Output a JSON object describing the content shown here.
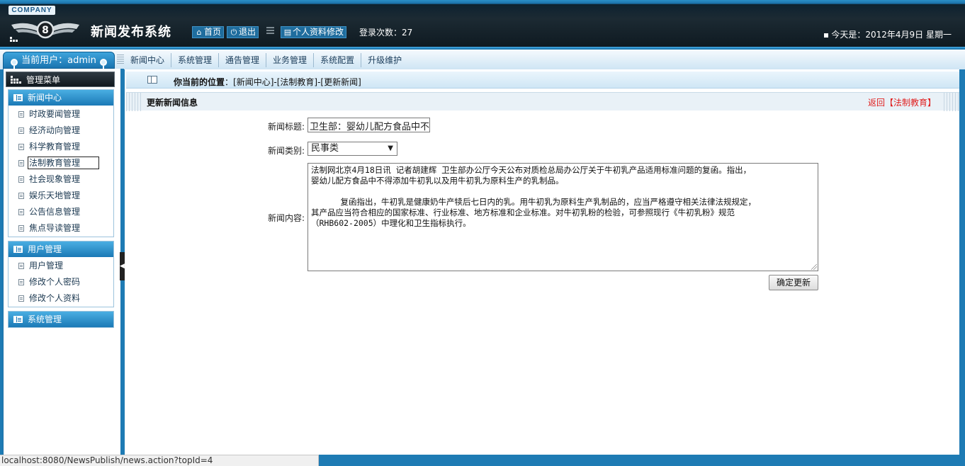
{
  "header": {
    "company": "COMPANY",
    "logo_letter": "8",
    "title": "新闻发布系统",
    "home": "首页",
    "logout": "退出",
    "profile": "个人资料修改",
    "login_count": "登录次数：27",
    "today": "今天是：2012年4月9日 星期一"
  },
  "user": {
    "current": "当前用户：admin"
  },
  "nav": [
    "新闻中心",
    "系统管理",
    "通告管理",
    "业务管理",
    "系统配置",
    "升级维护"
  ],
  "sidebar": {
    "menu_title": "管理菜单",
    "groups": [
      {
        "title": "新闻中心",
        "items": [
          "时政要闻管理",
          "经济动向管理",
          "科学教育管理",
          "法制教育管理",
          "社会现象管理",
          "娱乐天地管理",
          "公告信息管理",
          "焦点导读管理"
        ]
      },
      {
        "title": "用户管理",
        "items": [
          "用户管理",
          "修改个人密码",
          "修改个人资料"
        ]
      },
      {
        "title": "系统管理",
        "items": []
      }
    ],
    "active_item": "法制教育管理"
  },
  "breadcrumb": {
    "prefix": "你当前的位置",
    "path": "：[新闻中心]-[法制教育]-[更新新闻]"
  },
  "form": {
    "heading": "更新新闻信息",
    "back": "返回【法制教育】",
    "title_label": "新闻标题:",
    "title_value": "卫生部：婴幼儿配方食品中不得添加牛初乳",
    "type_label": "新闻类别:",
    "type_value": "民事类",
    "content_label": "新闻内容:",
    "content_value": "法制网北京4月18日讯 记者胡建辉 卫生部办公厅今天公布对质检总局办公厅关于牛初乳产品适用标准问题的复函。指出，\n婴幼儿配方食品中不得添加牛初乳以及用牛初乳为原料生产的乳制品。\n\n      复函指出，牛初乳是健康奶牛产犊后七日内的乳。用牛初乳为原料生产乳制品的，应当严格遵守相关法律法规规定，\n其产品应当符合相应的国家标准、行业标准、地方标准和企业标准。对牛初乳粉的检验，可参照现行《牛初乳粉》规范\n（RHB602-2005）中理化和卫生指标执行。",
    "submit": "确定更新"
  },
  "status_url": "localhost:8080/NewsPublish/news.action?topId=4",
  "colors": {
    "accent": "#1e7bb4",
    "link_red": "#e02020"
  }
}
